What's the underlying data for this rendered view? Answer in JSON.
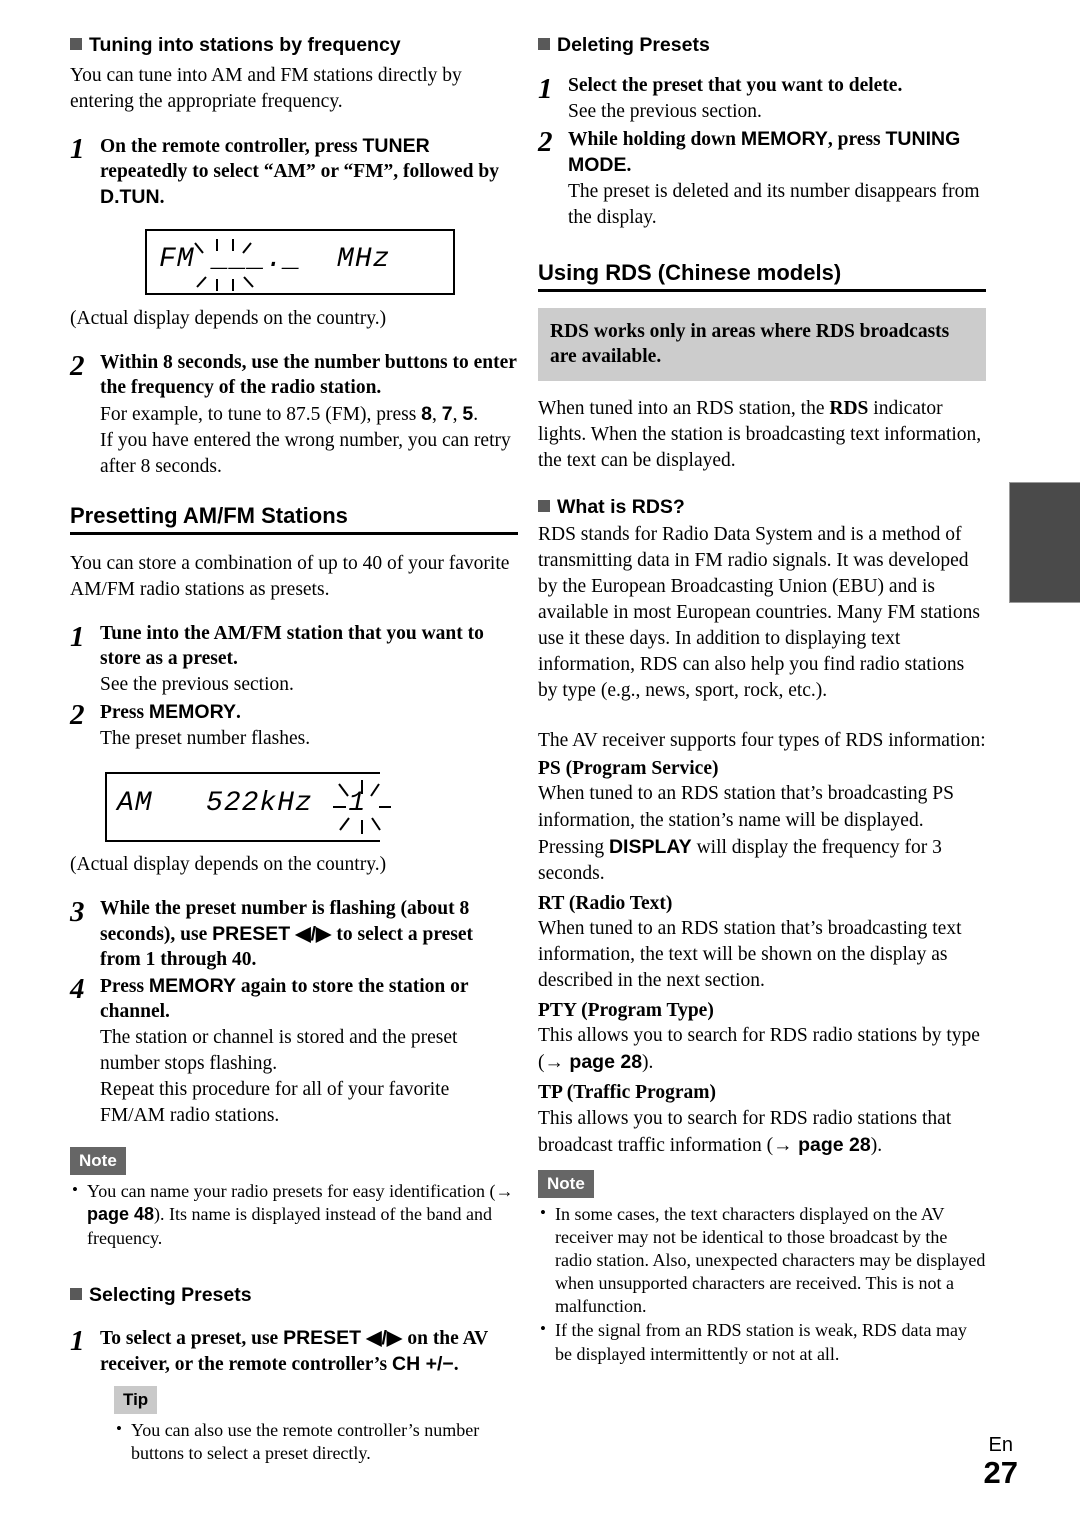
{
  "page": {
    "number": "27",
    "language_code": "En"
  },
  "colors": {
    "heading_square": "#595959",
    "note_chip_bg": "#666666",
    "tip_chip_bg": "#c9c9c9",
    "callout_bg": "#cccccc",
    "edge_tab": "#4a4a4a"
  },
  "left_column": {
    "tuning_section": {
      "heading": "Tuning into stations by frequency",
      "intro": "You can tune into AM and FM stations directly by entering the appropriate frequency.",
      "step1": {
        "num": "1",
        "title_parts": [
          {
            "text": "On the remote controller, press ",
            "style": "serif-bold"
          },
          {
            "text": "TUNER",
            "style": "sans-bold"
          },
          {
            "text": " repeatedly to select “AM” or “FM”, followed by ",
            "style": "serif-bold"
          },
          {
            "text": "D.TUN",
            "style": "sans-bold"
          },
          {
            "text": ".",
            "style": "serif-bold"
          }
        ]
      },
      "lcd_fm": {
        "band": "FM",
        "value": "___._",
        "unit": "MHz",
        "blinking": true
      },
      "caption": "(Actual display depends on the country.)",
      "step2": {
        "num": "2",
        "title": "Within 8 seconds, use the number buttons to enter the frequency of the radio station.",
        "sub1_parts": [
          {
            "text": "For example, to tune to 87.5 (FM), press ",
            "style": "serif"
          },
          {
            "text": "8",
            "style": "sans-bold"
          },
          {
            "text": ", ",
            "style": "serif"
          },
          {
            "text": "7",
            "style": "sans-bold"
          },
          {
            "text": ", ",
            "style": "serif"
          },
          {
            "text": "5",
            "style": "sans-bold"
          },
          {
            "text": ".",
            "style": "serif"
          }
        ],
        "sub2": "If you have entered the wrong number, you can retry after 8 seconds."
      }
    },
    "presetting_section": {
      "heading": "Presetting AM/FM Stations",
      "intro": "You can store a combination of up to 40 of your favorite AM/FM radio stations as presets.",
      "step1": {
        "num": "1",
        "title": "Tune into the AM/FM station that you want to store as a preset.",
        "sub": "See the previous section."
      },
      "step2": {
        "num": "2",
        "title_parts": [
          {
            "text": "Press ",
            "style": "serif-bold"
          },
          {
            "text": "MEMORY",
            "style": "sans-bold"
          },
          {
            "text": ".",
            "style": "serif-bold"
          }
        ],
        "sub": "The preset number flashes."
      },
      "lcd_am": {
        "band": "AM",
        "value": "522kHz",
        "preset": "1",
        "blinking": true
      },
      "caption": "(Actual display depends on the country.)",
      "step3": {
        "num": "3",
        "title_parts": [
          {
            "text": "While the preset number is flashing (about 8 seconds), use ",
            "style": "serif-bold"
          },
          {
            "text": "PRESET",
            "style": "sans-bold"
          },
          {
            "text": " ◀/▶ ",
            "style": "sans-bold"
          },
          {
            "text": "to select a preset from 1 through 40.",
            "style": "serif-bold"
          }
        ]
      },
      "step4": {
        "num": "4",
        "title_parts": [
          {
            "text": "Press ",
            "style": "serif-bold"
          },
          {
            "text": "MEMORY",
            "style": "sans-bold"
          },
          {
            "text": " again to store the station or channel.",
            "style": "serif-bold"
          }
        ],
        "sub1": "The station or channel is stored and the preset number stops flashing.",
        "sub2": "Repeat this procedure for all of your favorite FM/AM radio stations."
      },
      "note": {
        "label": "Note",
        "bullets_parts": [
          [
            {
              "text": "You can name your radio presets for easy identification (",
              "style": "serif"
            },
            {
              "text": "→ page 48",
              "style": "sans-bold"
            },
            {
              "text": "). Its name is displayed instead of the band and frequency.",
              "style": "serif"
            }
          ]
        ]
      }
    },
    "selecting_section": {
      "heading": "Selecting Presets",
      "step1": {
        "num": "1",
        "title_parts": [
          {
            "text": "To select a preset, use ",
            "style": "serif-bold"
          },
          {
            "text": "PRESET",
            "style": "sans-bold"
          },
          {
            "text": " ◀/▶ ",
            "style": "sans-bold"
          },
          {
            "text": "on the AV receiver, or the remote controller’s ",
            "style": "serif-bold"
          },
          {
            "text": "CH +/−",
            "style": "sans-bold"
          },
          {
            "text": ".",
            "style": "serif-bold"
          }
        ]
      },
      "tip": {
        "label": "Tip",
        "bullets": [
          "You can also use the remote controller’s number buttons to select a preset directly."
        ]
      }
    }
  },
  "right_column": {
    "deleting_section": {
      "heading": "Deleting Presets",
      "step1": {
        "num": "1",
        "title": "Select the preset that you want to delete.",
        "sub": "See the previous section."
      },
      "step2": {
        "num": "2",
        "title_parts": [
          {
            "text": "While holding down ",
            "style": "serif-bold"
          },
          {
            "text": "MEMORY",
            "style": "sans-bold"
          },
          {
            "text": ", press ",
            "style": "serif-bold"
          },
          {
            "text": "TUNING MODE",
            "style": "sans-bold"
          },
          {
            "text": ".",
            "style": "serif-bold"
          }
        ],
        "sub": "The preset is deleted and its number disappears from the display."
      }
    },
    "rds_section": {
      "heading": "Using RDS (Chinese models)",
      "callout": "RDS works only in areas where RDS broadcasts are available.",
      "intro_parts": [
        {
          "text": "When tuned into an RDS station, the ",
          "style": "serif"
        },
        {
          "text": "RDS",
          "style": "serif-bold"
        },
        {
          "text": " indicator lights. When the station is broadcasting text information, the text can be displayed.",
          "style": "serif"
        }
      ],
      "what_is_rds": {
        "heading": "What is RDS?",
        "paragraph": "RDS stands for Radio Data System and is a method of transmitting data in FM radio signals. It was developed by the European Broadcasting Union (EBU) and is available in most European countries. Many FM stations use it these days. In addition to displaying text information, RDS can also help you find radio stations by type (e.g., news, sport, rock, etc.).",
        "supports_line": "The AV receiver supports four types of RDS information:"
      },
      "definitions": [
        {
          "term": "PS (Program Service)",
          "body_parts": [
            {
              "text": "When tuned to an RDS station that’s broadcasting PS information, the station’s name will be displayed. Pressing ",
              "style": "serif"
            },
            {
              "text": "DISPLAY",
              "style": "sans-bold"
            },
            {
              "text": " will display the frequency for 3 seconds.",
              "style": "serif"
            }
          ]
        },
        {
          "term": "RT (Radio Text)",
          "body_parts": [
            {
              "text": "When tuned to an RDS station that’s broadcasting text information, the text will be shown on the display as described in the next section.",
              "style": "serif"
            }
          ]
        },
        {
          "term": "PTY (Program Type)",
          "body_parts": [
            {
              "text": "This allows you to search for RDS radio stations by type (",
              "style": "serif"
            },
            {
              "text": "→ page 28",
              "style": "sans-bold"
            },
            {
              "text": ").",
              "style": "serif"
            }
          ]
        },
        {
          "term": "TP (Traffic Program)",
          "body_parts": [
            {
              "text": "This allows you to search for RDS radio stations that broadcast traffic information (",
              "style": "serif"
            },
            {
              "text": "→ page 28",
              "style": "sans-bold"
            },
            {
              "text": ").",
              "style": "serif"
            }
          ]
        }
      ],
      "note": {
        "label": "Note",
        "bullets": [
          "In some cases, the text characters displayed on the AV receiver may not be identical to those broadcast by the radio station. Also, unexpected characters may be displayed when unsupported characters are received. This is not a malfunction.",
          "If the signal from an RDS station is weak, RDS data may be displayed intermittently or not at all."
        ]
      }
    }
  }
}
